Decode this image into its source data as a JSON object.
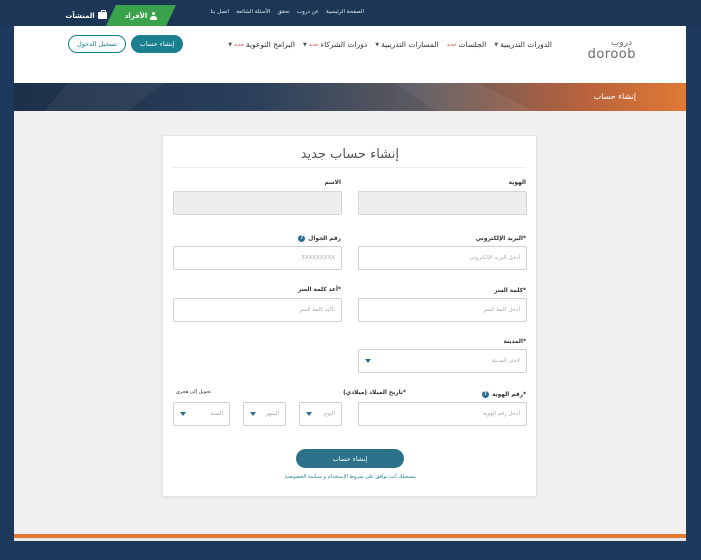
{
  "topbar": {
    "links": [
      "الصفحة الرئيسية",
      "عن دروب",
      "تحقق",
      "الأسئلة الشائعة",
      "اتصل بنا"
    ],
    "tab_individuals": "الأفراد",
    "tab_orgs": "المنشآت"
  },
  "logo": {
    "arabic": "دروب",
    "latin": "doroob"
  },
  "nav": {
    "items": [
      {
        "label": "الدورات التدريبية",
        "badge": ""
      },
      {
        "label": "الجلسات",
        "badge": "جديد"
      },
      {
        "label": "المسارات التدريبية",
        "badge": ""
      },
      {
        "label": "دورات الشركاء",
        "badge": "جديد"
      },
      {
        "label": "البرامج التوعوية",
        "badge": "جديد"
      }
    ],
    "create_account": "إنشاء حساب",
    "login": "تسجيل الدخول"
  },
  "banner": {
    "title": "إنشاء حساب"
  },
  "form": {
    "title": "إنشاء حساب جديد",
    "identity_label": "الهوية",
    "name_label": "الاسم",
    "email_label": "البريد الإلكتروني*",
    "email_placeholder": "أدخل البريد الإلكتروني",
    "mobile_label": "رقم الجوال",
    "mobile_placeholder": "5XXXXXXXX",
    "password_label": "كلمة السر*",
    "password_placeholder": "أدخل كلمة السر",
    "confirm_label": "أعد كلمة السر*",
    "confirm_placeholder": "تأكيد كلمة السر",
    "city_label": "المدينة*",
    "city_placeholder": "لاختر المدينة",
    "id_number_label": "رقم الهوية*",
    "id_number_placeholder": "أدخل رقم الهوية",
    "dob_label": "تاريخ الميلاد (ميلادي)*",
    "convert_hijri": "تحويل إلى هجري",
    "day_placeholder": "اليوم",
    "month_placeholder": "الشهر",
    "year_placeholder": "السنة",
    "submit": "إنشاء حساب",
    "terms": "بتسجيلك أنت توافق على شروط الإستخدام و سياسة الخصوصية"
  },
  "colors": {
    "accent": "#1a7f8e",
    "brand_orange": "#e07a35",
    "page_bg": "#1d3a5c"
  }
}
